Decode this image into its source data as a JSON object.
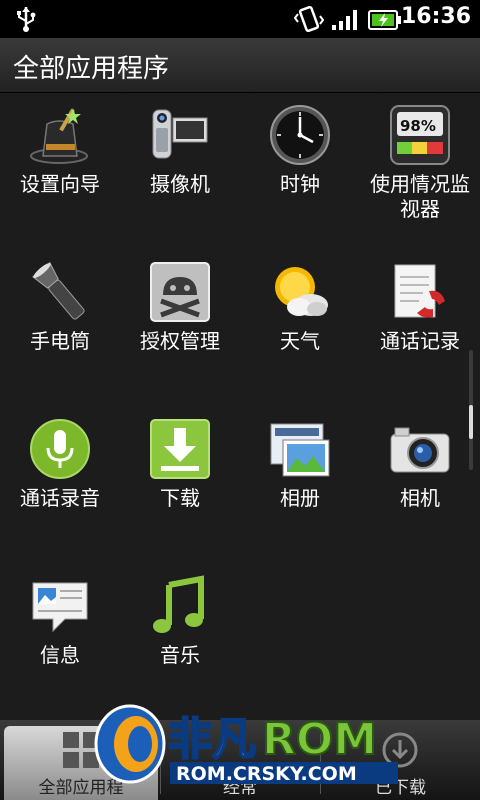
{
  "status_bar": {
    "time": "16:36",
    "icons": [
      "usb-icon",
      "vibrate-icon",
      "signal-icon",
      "battery-charging-icon"
    ]
  },
  "title": "全部应用程序",
  "apps": [
    {
      "label": "设置向导",
      "icon": "settings-wizard-icon"
    },
    {
      "label": "摄像机",
      "icon": "camcorder-icon"
    },
    {
      "label": "时钟",
      "icon": "clock-icon"
    },
    {
      "label": "使用情况监视器",
      "icon": "usage-monitor-icon",
      "icon_text": "98%"
    },
    {
      "label": "手电筒",
      "icon": "flashlight-icon"
    },
    {
      "label": "授权管理",
      "icon": "superuser-icon"
    },
    {
      "label": "天气",
      "icon": "weather-icon"
    },
    {
      "label": "通话记录",
      "icon": "call-log-icon"
    },
    {
      "label": "通话录音",
      "icon": "call-recorder-icon"
    },
    {
      "label": "下载",
      "icon": "download-icon"
    },
    {
      "label": "相册",
      "icon": "gallery-icon"
    },
    {
      "label": "相机",
      "icon": "camera-icon"
    },
    {
      "label": "信息",
      "icon": "messages-icon"
    },
    {
      "label": "音乐",
      "icon": "music-icon"
    }
  ],
  "tabs": [
    {
      "label": "全部应用程",
      "icon": "all-apps-grid-icon",
      "active": true
    },
    {
      "label": "经常",
      "icon": "frequent-icon",
      "active": false
    },
    {
      "label": "已下载",
      "icon": "downloaded-icon",
      "active": false
    }
  ],
  "watermark": {
    "brand_cn": "非凡",
    "brand_en": "ROM",
    "url": "ROM.CRSKY.COM"
  },
  "colors": {
    "background": "#1c1c1c",
    "status_bar": "#000000",
    "accent_green": "#8cc63f"
  }
}
